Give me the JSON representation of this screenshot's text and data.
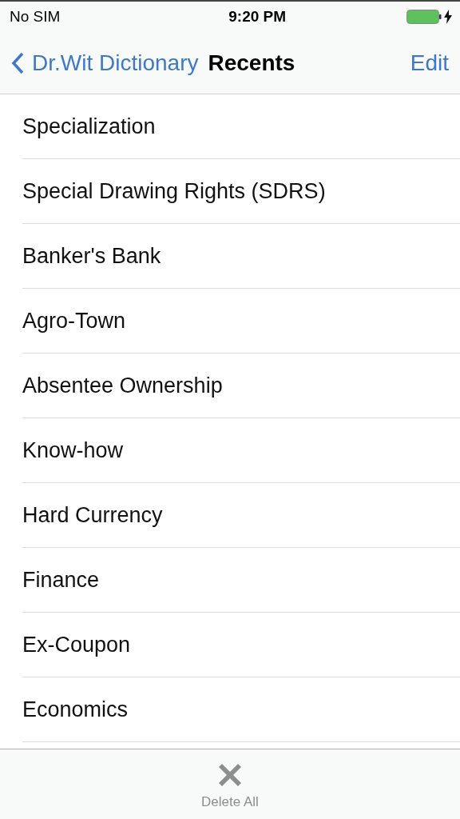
{
  "status_bar": {
    "carrier": "No SIM",
    "time": "9:20 PM"
  },
  "nav": {
    "back": "Dr.Wit Dictionary",
    "title": "Recents",
    "action": "Edit"
  },
  "items": [
    "Specialization",
    "Special Drawing Rights (SDRS)",
    "Banker's Bank",
    "Agro-Town",
    "Absentee Ownership",
    "Know-how",
    "Hard Currency",
    "Finance",
    "Ex-Coupon",
    "Economics"
  ],
  "toolbar": {
    "label": "Delete All"
  }
}
